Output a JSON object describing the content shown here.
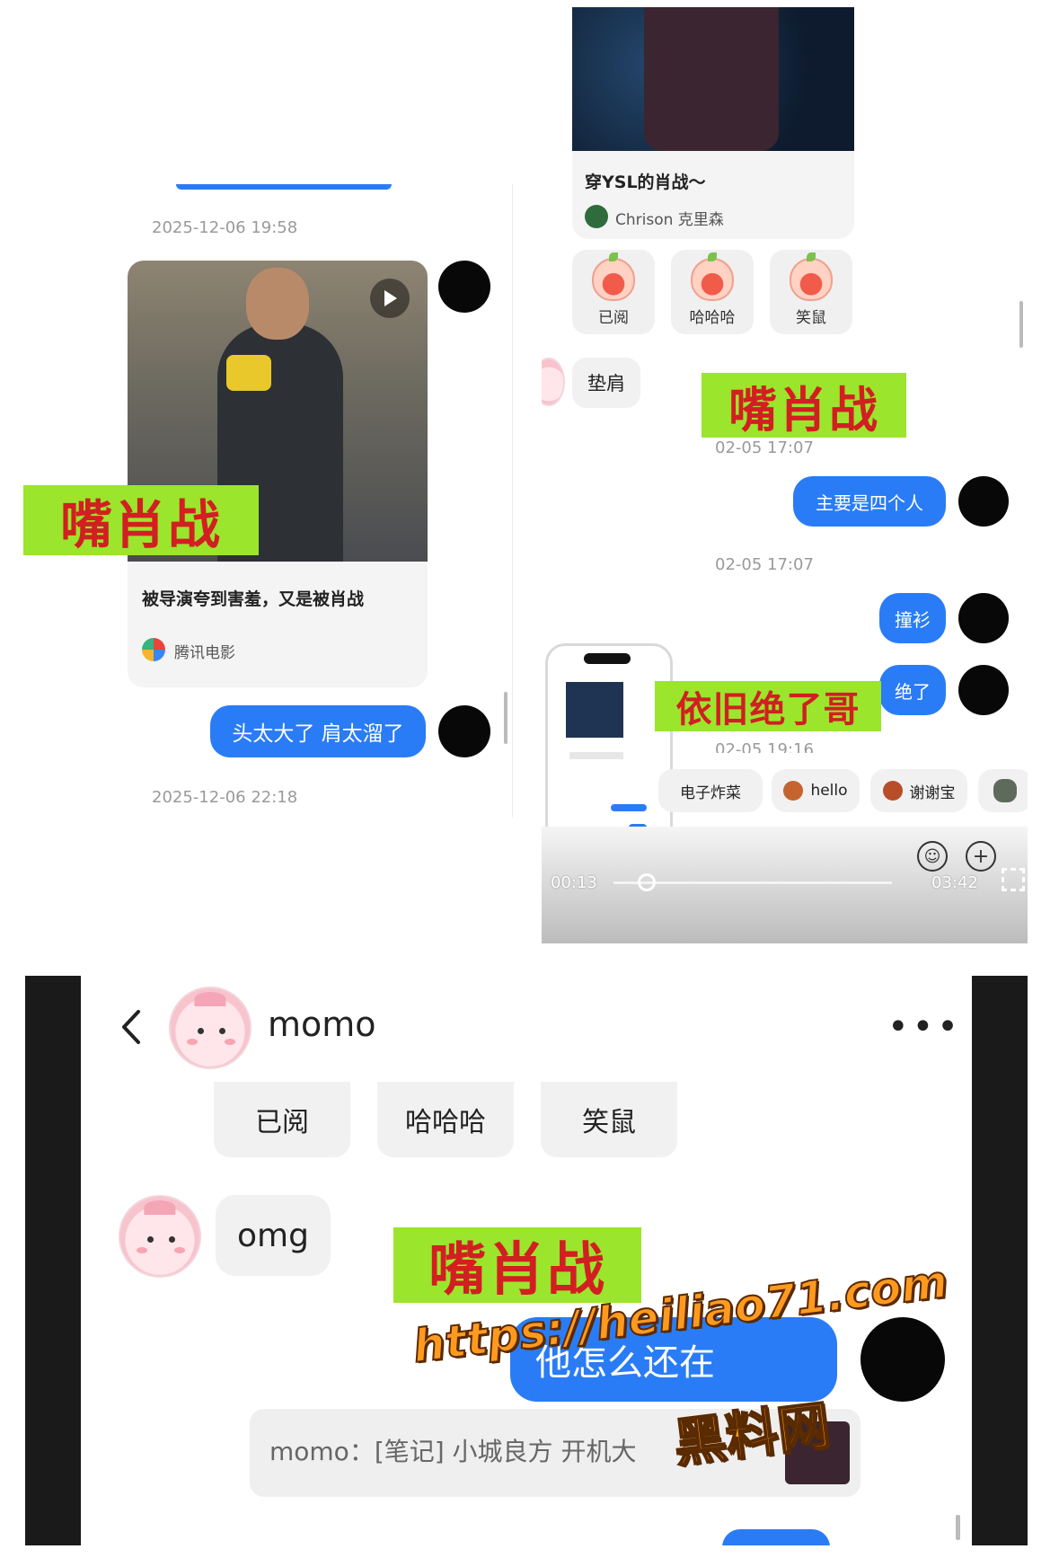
{
  "panel_left": {
    "timestamp_1": "2025-12-06 19:58",
    "card_title": "被导演夸到害羞，又是被肖战",
    "card_source": "腾讯电影",
    "tag": "嘴肖战",
    "sent_message": "头太大了 肩太溜了",
    "timestamp_2": "2025-12-06 22:18"
  },
  "panel_right": {
    "card_title": "穿YSL的肖战～",
    "card_author": "Chrison 克里森",
    "emoji_tiles": [
      "已阅",
      "哈哈哈",
      "笑鼠"
    ],
    "received_message": "垫肩",
    "tag_1": "嘴肖战",
    "timestamp_1": "02-05 17:07",
    "sent_message_1": "主要是四个人",
    "timestamp_2": "02-05 17:07",
    "sent_message_2": "撞衫",
    "sent_message_3": "绝了",
    "tag_2": "依旧绝了哥",
    "timestamp_3": "02-05 19:16",
    "quick_replies": [
      "电子炸菜",
      "hello",
      "谢谢宝"
    ],
    "video_time_current": "00:13",
    "video_time_total": "03:42"
  },
  "panel_bottom": {
    "chat_name": "momo",
    "emoji_tiles": [
      "已阅",
      "哈哈哈",
      "笑鼠"
    ],
    "received_message": "omg",
    "tag": "嘴肖战",
    "sent_message": "他怎么还在",
    "quote_preview": "momo：[笔记] 小城良方 开机大"
  },
  "watermark": {
    "url": "https://heiliao71.com",
    "name": "黑料网"
  },
  "colors": {
    "bubble_blue": "#2a7cf6",
    "tag_green": "#9be52c",
    "tag_red": "#d21f22",
    "watermark_orange": "#ff9a1f"
  }
}
